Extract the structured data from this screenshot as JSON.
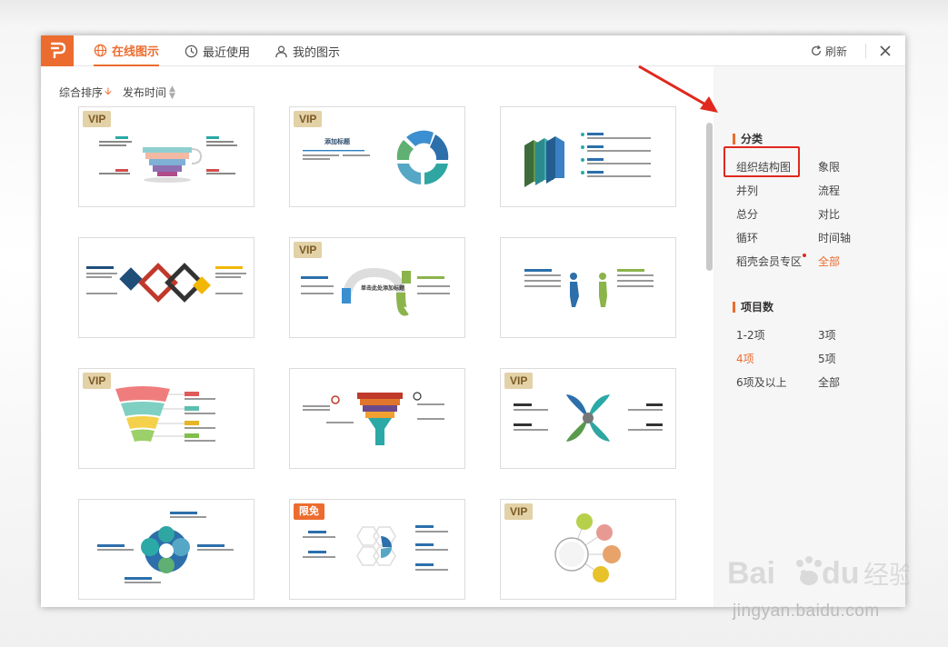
{
  "app": {
    "logo_letter": "P"
  },
  "tabs": [
    {
      "label": "在线图示",
      "icon": "globe-icon",
      "active": true
    },
    {
      "label": "最近使用",
      "icon": "clock-icon",
      "active": false
    },
    {
      "label": "我的图示",
      "icon": "user-icon",
      "active": false
    }
  ],
  "toolbar": {
    "refresh_label": "刷新",
    "close_icon": "close-icon"
  },
  "sort": {
    "primary": "综合排序",
    "secondary": "发布时间"
  },
  "cards": [
    {
      "badge": "VIP",
      "kind": "funnel-cup"
    },
    {
      "badge": "VIP",
      "kind": "cycle-title",
      "title": "添加标题"
    },
    {
      "badge": "",
      "kind": "3d-layers"
    },
    {
      "badge": "",
      "kind": "diamonds"
    },
    {
      "badge": "VIP",
      "kind": "wave-title",
      "title": "单击此处添加标题"
    },
    {
      "badge": "",
      "kind": "figures"
    },
    {
      "badge": "VIP",
      "kind": "fan"
    },
    {
      "badge": "",
      "kind": "funnel"
    },
    {
      "badge": "VIP",
      "kind": "petals"
    },
    {
      "badge": "",
      "kind": "gear-flower"
    },
    {
      "badge": "限免",
      "kind": "hexagons"
    },
    {
      "badge": "VIP",
      "kind": "bubbles"
    }
  ],
  "sidebar": {
    "category_title": "分类",
    "categories": [
      {
        "label": "组织结构图",
        "active": false,
        "highlighted": true
      },
      {
        "label": "象限",
        "active": false
      },
      {
        "label": "并列",
        "active": false
      },
      {
        "label": "流程",
        "active": false
      },
      {
        "label": "总分",
        "active": false
      },
      {
        "label": "对比",
        "active": false
      },
      {
        "label": "循环",
        "active": false
      },
      {
        "label": "时间轴",
        "active": false
      },
      {
        "label": "稻壳会员专区",
        "active": false,
        "dot": true
      },
      {
        "label": "全部",
        "active": true
      }
    ],
    "count_title": "项目数",
    "counts": [
      {
        "label": "1-2项",
        "active": false
      },
      {
        "label": "3项",
        "active": false
      },
      {
        "label": "4项",
        "active": true
      },
      {
        "label": "5项",
        "active": false
      },
      {
        "label": "6项及以上",
        "active": false
      },
      {
        "label": "全部",
        "active": false
      }
    ]
  },
  "colors": {
    "accent": "#ec6c2f",
    "highlight": "#e0281e",
    "vip_bg": "#e3d1a7"
  },
  "watermark": {
    "text": "jingyan.baidu.com",
    "brand": "Bai",
    "brand_suffix": "du",
    "cn": "经验"
  }
}
